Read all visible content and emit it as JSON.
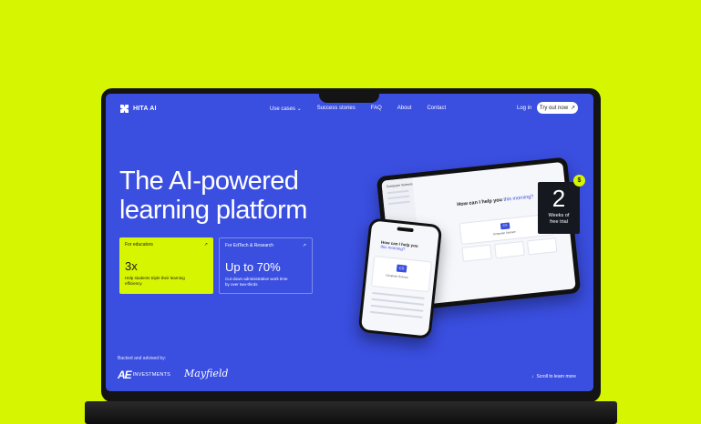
{
  "brand": {
    "name": "HITA AI"
  },
  "nav": {
    "items": [
      "Use cases",
      "Success stories",
      "FAQ",
      "About",
      "Contact"
    ],
    "login": "Log in",
    "cta": "Try out now"
  },
  "hero": {
    "line1": "The AI-powered",
    "line2": "learning platform"
  },
  "cards": [
    {
      "title": "For educators",
      "stat": "3x",
      "description": "Help students triple their learning efficiency"
    },
    {
      "title": "For EdTech & Research",
      "stat": "Up to 70%",
      "description": "Cut down administrative work time by over two-thirds"
    }
  ],
  "backed": {
    "label": "Backed and advised by:",
    "partners": [
      "AE",
      "INVESTMENTS",
      "Mayfield"
    ]
  },
  "scroll_hint": "Scroll to learn more",
  "badge": {
    "number": "2",
    "label": "Weeks of free trial",
    "symbol": "$"
  },
  "device_preview": {
    "tablet_sidebar_title": "Computer Science",
    "question_prefix": "How can I help you",
    "question_accent": "this morning?",
    "course_code": "CS",
    "course_name": "Computer Science"
  },
  "colors": {
    "background": "#d6f500",
    "screen": "#3a4ee0",
    "accent": "#d6f500"
  }
}
